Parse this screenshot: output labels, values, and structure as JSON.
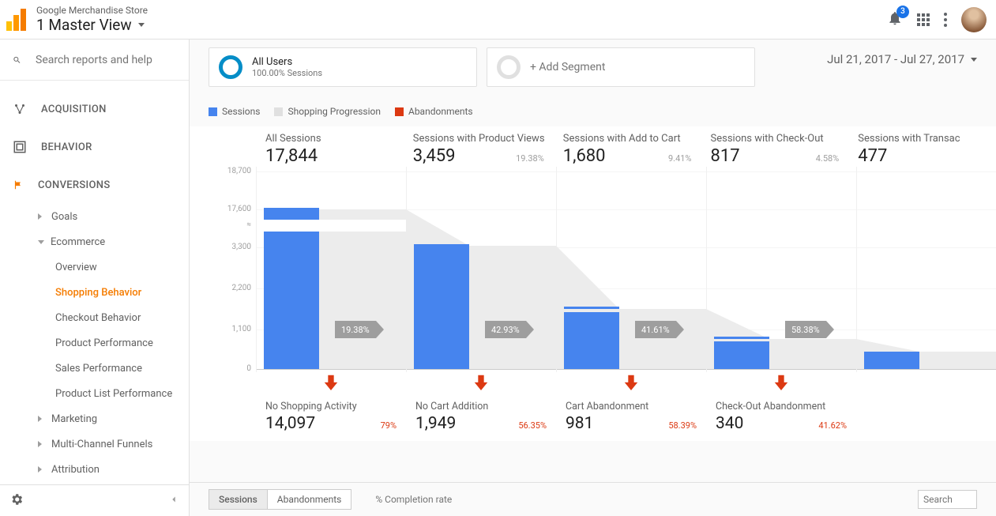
{
  "header": {
    "store_name": "Google Merchandise Store",
    "view_name": "1 Master View",
    "notification_count": "3"
  },
  "search": {
    "placeholder": "Search reports and help"
  },
  "nav": {
    "acquisition": "ACQUISITION",
    "behavior": "BEHAVIOR",
    "conversions": "CONVERSIONS",
    "goals": "Goals",
    "ecommerce": "Ecommerce",
    "overview": "Overview",
    "shopping_behavior": "Shopping Behavior",
    "checkout_behavior": "Checkout Behavior",
    "product_performance": "Product Performance",
    "sales_performance": "Sales Performance",
    "product_list_performance": "Product List Performance",
    "marketing": "Marketing",
    "multi_channel_funnels": "Multi-Channel Funnels",
    "attribution": "Attribution"
  },
  "segments": {
    "all_users_title": "All Users",
    "all_users_sub": "100.00% Sessions",
    "add_segment": "+ Add Segment"
  },
  "date_range": "Jul 21, 2017 - Jul 27, 2017",
  "legend": {
    "sessions": "Sessions",
    "shopping_progression": "Shopping Progression",
    "abandonments": "Abandonments"
  },
  "axis": {
    "t0": "18,700",
    "t1": "17,600",
    "t2": "3,300",
    "t3": "2,200",
    "t4": "1,100",
    "t5": "0"
  },
  "chart_data": {
    "type": "bar",
    "title": "Shopping Behavior Funnel",
    "y_axis_note": "broken axis between 3,300 and 17,600",
    "stages": [
      {
        "label": "All Sessions",
        "value": 17844,
        "pct_of_prev": null,
        "progression_pct": 19.38,
        "abandon_label": "No Shopping Activity",
        "abandon_value": 14097,
        "abandon_pct": 79
      },
      {
        "label": "Sessions with Product Views",
        "value": 3459,
        "pct_of_prev": 19.38,
        "progression_pct": 42.93,
        "abandon_label": "No Cart Addition",
        "abandon_value": 1949,
        "abandon_pct": 56.35
      },
      {
        "label": "Sessions with Add to Cart",
        "value": 1680,
        "pct_of_prev": 9.41,
        "progression_pct": 41.61,
        "abandon_label": "Cart Abandonment",
        "abandon_value": 981,
        "abandon_pct": 58.39
      },
      {
        "label": "Sessions with Check-Out",
        "value": 817,
        "pct_of_prev": 4.58,
        "progression_pct": 58.38,
        "abandon_label": "Check-Out Abandonment",
        "abandon_value": 340,
        "abandon_pct": 41.62
      },
      {
        "label": "Sessions with Transactions",
        "value": 477,
        "pct_of_prev": null,
        "progression_pct": null,
        "abandon_label": null,
        "abandon_value": null,
        "abandon_pct": null
      }
    ]
  },
  "funnel": {
    "c0": {
      "label": "All Sessions",
      "value": "17,844",
      "pct": ""
    },
    "c1": {
      "label": "Sessions with Product Views",
      "value": "3,459",
      "pct": "19.38%"
    },
    "c2": {
      "label": "Sessions with Add to Cart",
      "value": "1,680",
      "pct": "9.41%"
    },
    "c3": {
      "label": "Sessions with Check-Out",
      "value": "817",
      "pct": "4.58%"
    },
    "c4": {
      "label": "Sessions with Transac",
      "value": "477",
      "pct": ""
    }
  },
  "progress": {
    "p0": "19.38%",
    "p1": "42.93%",
    "p2": "41.61%",
    "p3": "58.38%"
  },
  "abandon": {
    "a0": {
      "label": "No Shopping Activity",
      "value": "14,097",
      "pct": "79%"
    },
    "a1": {
      "label": "No Cart Addition",
      "value": "1,949",
      "pct": "56.35%"
    },
    "a2": {
      "label": "Cart Abandonment",
      "value": "981",
      "pct": "58.39%"
    },
    "a3": {
      "label": "Check-Out Abandonment",
      "value": "340",
      "pct": "41.62%"
    }
  },
  "tabs": {
    "sessions": "Sessions",
    "abandonments": "Abandonments",
    "completion_rate": "% Completion rate",
    "search_placeholder": "Search"
  }
}
